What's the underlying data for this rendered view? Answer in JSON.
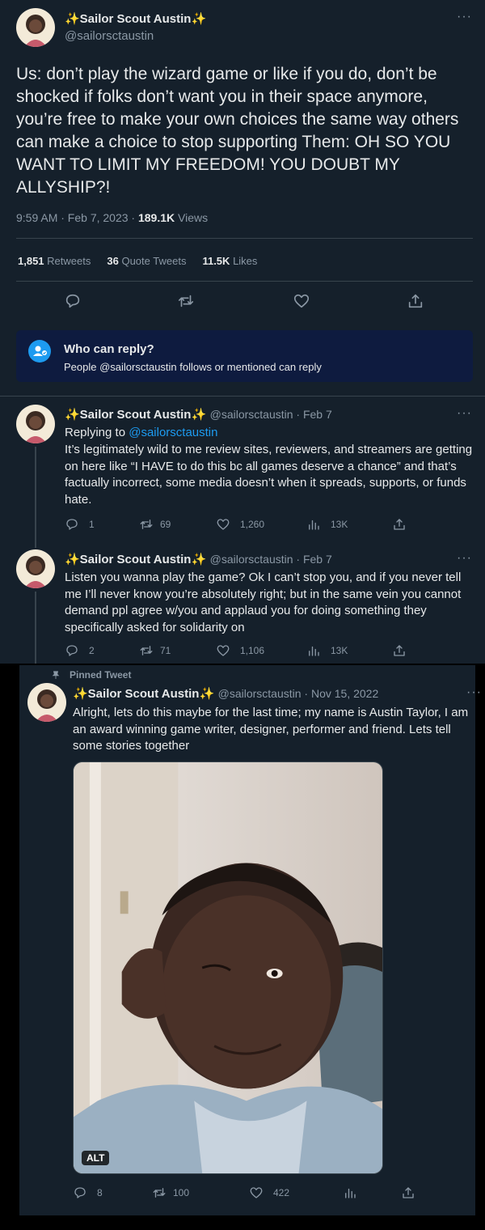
{
  "main_tweet": {
    "name": "✨Sailor Scout Austin✨",
    "handle": "@sailorsctaustin",
    "more": "···",
    "text": "Us: don’t play the wizard game or like if you do, don’t be shocked if folks don’t want you in their space anymore, you’re free to make your own choices the same way others can make a choice to stop supporting Them: OH SO YOU WANT TO LIMIT MY FREEDOM! YOU DOUBT MY ALLYSHIP?!",
    "timestamp": "9:59 AM · Feb 7, 2023 · ",
    "views_count": "189.1K",
    "views_label": "Views",
    "retweets_count": "1,851",
    "retweets_label": "Retweets",
    "quotes_count": "36",
    "quotes_label": "Quote Tweets",
    "likes_count": "11.5K",
    "likes_label": "Likes"
  },
  "who_can_reply": {
    "title": "Who can reply?",
    "text": "People @sailorsctaustin follows or mentioned can reply"
  },
  "replies": [
    {
      "name": "✨Sailor Scout Austin✨",
      "meta": "@sailorsctaustin · Feb 7",
      "replying_prefix": "Replying to ",
      "replying_handle": "@sailorsctaustin",
      "text": "It’s legitimately wild to me review sites, reviewers, and streamers are getting on here like “I HAVE to do this bc all games deserve a chance” and that’s factually incorrect, some media doesn’t when it spreads, supports, or funds hate.",
      "replies": "1",
      "retweets": "69",
      "likes": "1,260",
      "views": "13K"
    },
    {
      "name": "✨Sailor Scout Austin✨",
      "meta": "@sailorsctaustin · Feb 7",
      "text": "Listen you wanna play the game? Ok I can’t stop you, and if you never tell me I’ll never know you’re absolutely right; but in the same vein you cannot demand ppl agree w/you and applaud you for doing something they specifically asked for solidarity on",
      "replies": "2",
      "retweets": "71",
      "likes": "1,106",
      "views": "13K"
    }
  ],
  "pinned": {
    "label": "Pinned Tweet",
    "name": "✨Sailor Scout Austin✨",
    "meta": "@sailorsctaustin · Nov 15, 2022",
    "text": "Alright, lets do this maybe for the last time; my name is Austin Taylor, I am an award winning game writer, designer, performer and friend. Lets tell some stories together",
    "alt_badge": "ALT",
    "replies": "8",
    "retweets": "100",
    "likes": "422"
  },
  "colors": {
    "background": "#15202b",
    "border": "#38444d",
    "muted": "#8b98a5",
    "link": "#1d9bf0",
    "reply_banner": "#0e1b3f"
  }
}
